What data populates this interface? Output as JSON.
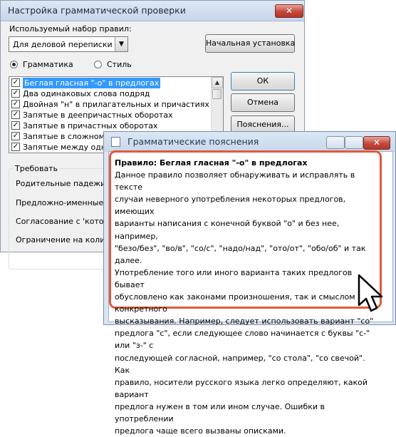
{
  "main_dialog": {
    "title": "Настройка грамматической проверки",
    "ruleset_label": "Используемый набор правил:",
    "ruleset_value": "Для деловой переписки",
    "reset_button": "Начальная установка",
    "radio_grammar": "Грамматика",
    "radio_style": "Стиль",
    "rules": [
      {
        "label": "Беглая гласная \"-о\" в предлогах",
        "checked": true,
        "selected": true
      },
      {
        "label": "Два одинаковых слова подряд",
        "checked": true,
        "selected": false
      },
      {
        "label": "Двойная \"н\" в прилагательных и причастиях",
        "checked": true,
        "selected": false
      },
      {
        "label": "Запятые в деепричастных оборотах",
        "checked": true,
        "selected": false
      },
      {
        "label": "Запятые в причастных оборотах",
        "checked": true,
        "selected": false
      },
      {
        "label": "Запятые в сложном пре",
        "checked": true,
        "selected": false
      },
      {
        "label": "Запятые между одноро",
        "checked": true,
        "selected": false
      }
    ],
    "ok_button": "ОК",
    "cancel_button": "Отмена",
    "explain_button": "Пояснения...",
    "require_group": "Требовать",
    "require_items": [
      "Родительные падежи под",
      "Предложно-именные груп",
      "Согласование с 'который':",
      "Ограничение на количест"
    ]
  },
  "help_window": {
    "title": "Грамматические пояснения",
    "heading": "Правило: Беглая гласная \"-о\" в предлогах",
    "lines": [
      "Данное правило позволяет обнаруживать и исправлять в тексте",
      "случаи неверного употребления некоторых предлогов, имеющих",
      "варианты написания с конечной буквой \"о\" и без нее, например,",
      "\"безо/без\", \"во/в\", \"со/с\", \"надо/над\", \"ото/от\", \"обо/об\" и так далее.",
      "Употребление того или иного варианта таких предлогов бывает",
      "обусловлено как законами произношения, так и смыслом конкретного",
      "высказывания. Например, следует использовать вариант \"со\"",
      "предлога \"с\", если следующее слово начинается с буквы \"с-\" или \"з-\" с",
      "последующей согласной, например, \"со стола\", \"со свечой\". Как",
      "правило, носители русского языка легко определяют, какой вариант",
      "предлога нужен в том или ином случае. Ошибки в употреблении",
      "предлога чаще всего вызваны описками."
    ]
  },
  "colors": {
    "highlight": "#e05a3c",
    "selection": "#3399ff"
  }
}
